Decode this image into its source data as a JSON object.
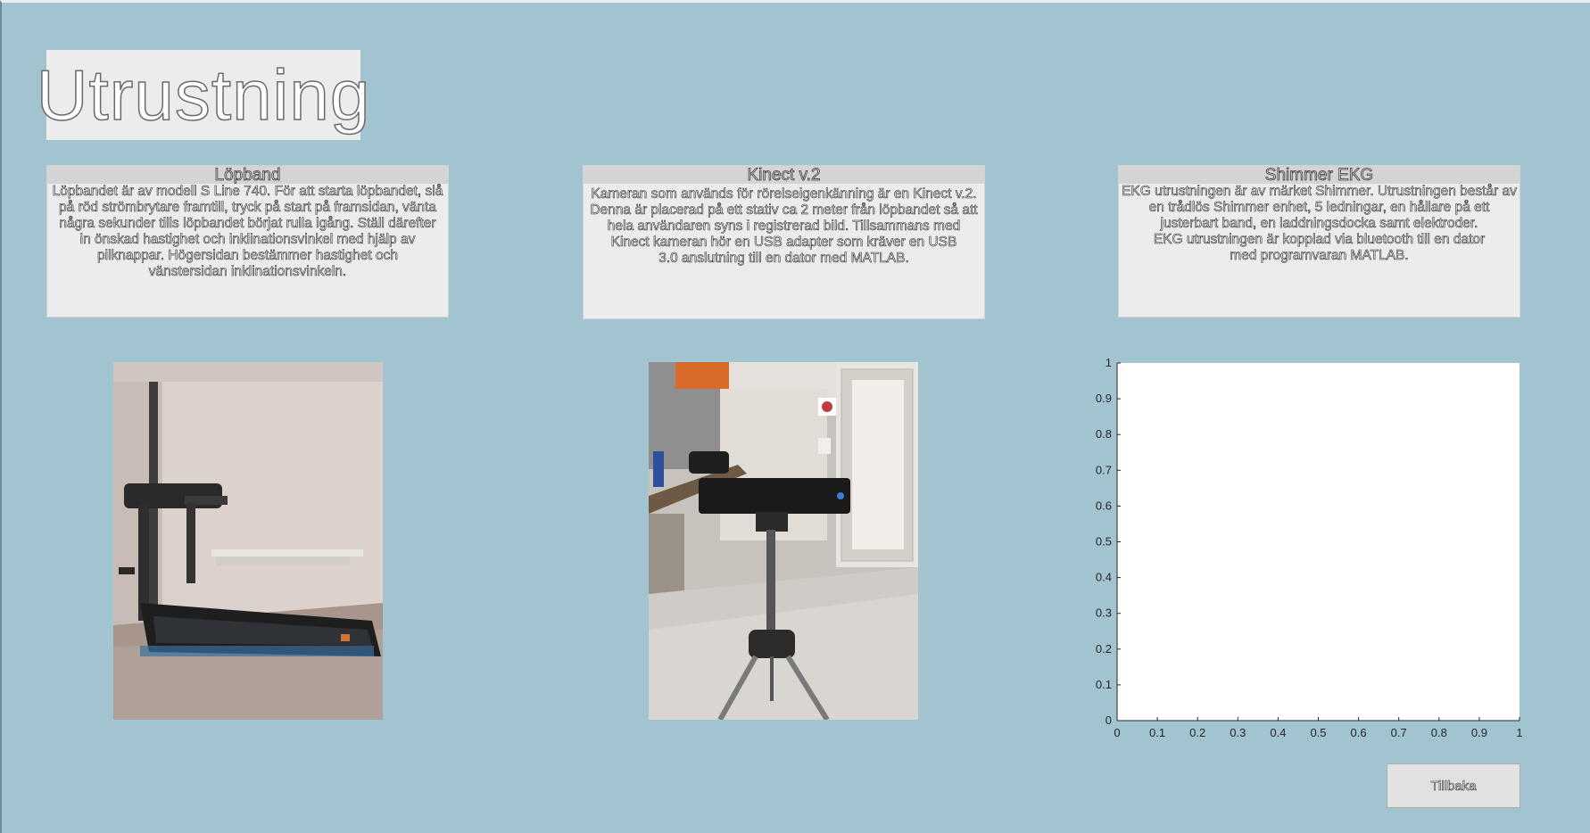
{
  "window": {
    "title": "Utrustning"
  },
  "panels": [
    {
      "header": "Löpband",
      "lines": [
        "Löpbandet är av modell S Line 740. För att starta löpbandet, slå",
        "på röd strömbrytare framtill, tryck på start på framsidan, vänta",
        "några sekunder tills löpbandet börjat rulla igång. Ställ därefter",
        "in önskad hastighet och inklinationsvinkel med hjälp av",
        "pilknappar. Högersidan bestämmer hastighet och",
        "vänstersidan inklinationsvinkeln."
      ]
    },
    {
      "header": "Kinect v.2",
      "lines": [
        "Kameran som används för rörelseigenkänning är en Kinect v.2.",
        "Denna är placerad på ett stativ ca 2 meter från löpbandet så att",
        "hela användaren syns i registrerad bild. Tillsammans med",
        "Kinect kameran hör en USB adapter som kräver en USB",
        "3.0 anslutning till en dator med MATLAB."
      ]
    },
    {
      "header": "Shimmer EKG",
      "lines": [
        "EKG utrustningen är av märket Shimmer. Utrustningen består av",
        "en trådlös Shimmer enhet, 5 ledningar, en hållare på ett",
        "justerbart band, en laddningsdocka samt elektroder.",
        "EKG utrustningen är kopplad via bluetooth till en dator",
        "med programvaran MATLAB."
      ]
    }
  ],
  "chart_data": {
    "type": "line",
    "title": "",
    "xlabel": "",
    "ylabel": "",
    "xlim": [
      0,
      1
    ],
    "ylim": [
      0,
      1
    ],
    "x_ticks": [
      "0",
      "0.1",
      "0.2",
      "0.3",
      "0.4",
      "0.5",
      "0.6",
      "0.7",
      "0.8",
      "0.9",
      "1"
    ],
    "y_ticks": [
      "0",
      "0.1",
      "0.2",
      "0.3",
      "0.4",
      "0.5",
      "0.6",
      "0.7",
      "0.8",
      "0.9",
      "1"
    ],
    "series": [],
    "grid": false
  },
  "buttons": {
    "back_label": "Tillbaka"
  },
  "icons": {
    "treadmill_photo": "treadmill-photo",
    "kinect_photo": "kinect-on-tripod-photo"
  },
  "colors": {
    "background": "#a2c3d0",
    "panel": "#ececec",
    "axes_bg": "#ffffff"
  }
}
